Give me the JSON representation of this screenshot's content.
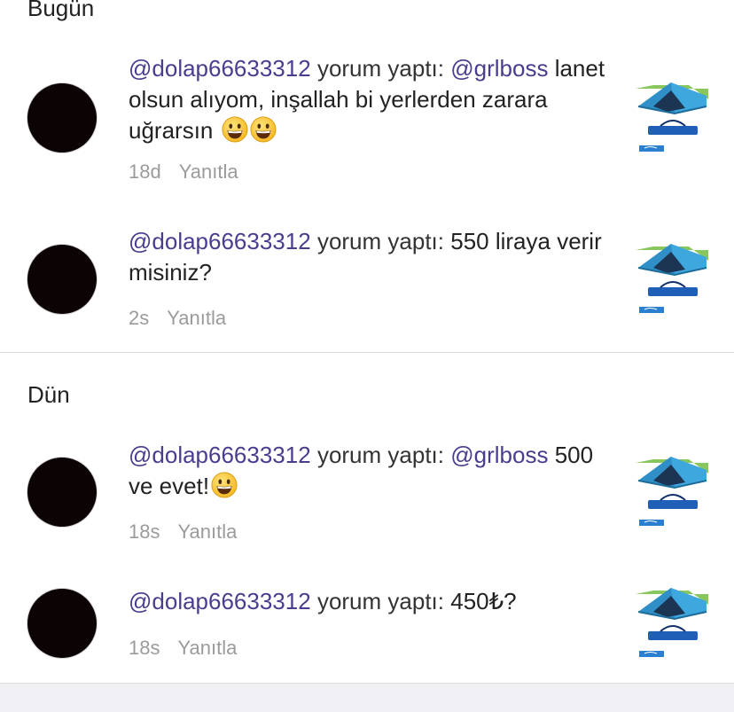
{
  "sections": [
    {
      "header": "Bugün",
      "comments": [
        {
          "user": "@dolap66633312",
          "action": "yorum yaptı:",
          "mention": "@grlboss",
          "text": "lanet olsun alıyom, inşallah bi yerlerden zarara uğrarsın",
          "emoji": [
            "grinning-face",
            "grinning-face"
          ],
          "time": "18d",
          "reply": "Yanıtla",
          "thumbnail": "tent-product-thumbnail"
        },
        {
          "user": "@dolap66633312",
          "action": "yorum yaptı:",
          "text": "550 liraya verir misiniz?",
          "time": "2s",
          "reply": "Yanıtla",
          "thumbnail": "tent-product-thumbnail"
        }
      ]
    },
    {
      "header": "Dün",
      "comments": [
        {
          "user": "@dolap66633312",
          "action": "yorum yaptı:",
          "mention": "@grlboss",
          "text": "500 ve evet!",
          "emoji": [
            "grinning-face"
          ],
          "time": "18s",
          "reply": "Yanıtla",
          "thumbnail": "tent-product-thumbnail"
        },
        {
          "user": "@dolap66633312",
          "action": "yorum yaptı:",
          "text": "450₺?",
          "time": "18s",
          "reply": "Yanıtla",
          "thumbnail": "tent-product-thumbnail"
        }
      ]
    }
  ],
  "colors": {
    "mention": "#4a3d8f",
    "text": "#222222",
    "meta": "#9b9b9b",
    "avatar": "#0c0304",
    "divider": "#dcdce0",
    "footer_band": "#efeff4",
    "tent_blue": "#3ea7de",
    "grass_green": "#7cc04b",
    "bag_blue": "#1f5fb8"
  }
}
